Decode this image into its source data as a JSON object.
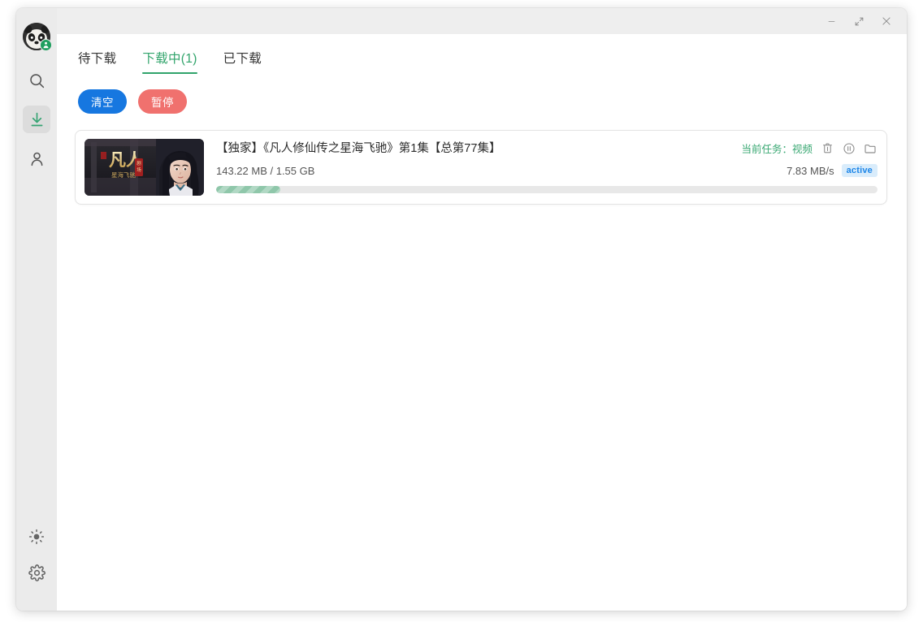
{
  "window": {
    "controls": {
      "minimize_label": "—",
      "minimize_icon": "minimize-icon",
      "maximize_icon": "maximize-icon",
      "close_label": "✕",
      "close_icon": "close-icon"
    }
  },
  "sidebar": {
    "avatar": {
      "name": "panda-avatar",
      "badge_icon": "user-verified-badge-icon"
    },
    "items": [
      {
        "icon": "search-icon",
        "name": "sidebar-item-search",
        "active": false
      },
      {
        "icon": "download-icon",
        "name": "sidebar-item-downloads",
        "active": true
      },
      {
        "icon": "person-icon",
        "name": "sidebar-item-account",
        "active": false
      }
    ],
    "bottom_items": [
      {
        "icon": "brightness-icon",
        "name": "sidebar-item-theme"
      },
      {
        "icon": "gear-icon",
        "name": "sidebar-item-settings"
      }
    ]
  },
  "tabs": [
    {
      "label": "待下载",
      "active": false
    },
    {
      "label": "下载中(1)",
      "active": true
    },
    {
      "label": "已下载",
      "active": false
    }
  ],
  "actions": {
    "clear_label": "清空",
    "pause_label": "暂停",
    "clear_color": "#1677e0",
    "pause_color": "#f0716e"
  },
  "downloads": [
    {
      "title": "【独家】《凡人修仙传之星海飞驰》第1集【总第77集】",
      "size_text": "143.22 MB / 1.55 GB",
      "downloaded": "143.22 MB",
      "total": "1.55 GB",
      "speed": "7.83 MB/s",
      "status_badge": "active",
      "current_task_label": "当前任务：视频",
      "progress_percent": 9.7,
      "thumbnail": {
        "name": "video-thumbnail",
        "title_cn": "凡人",
        "subtitle_cn": "星海飞驰"
      },
      "row_icons": [
        {
          "icon": "trash-icon",
          "name": "delete-task-button"
        },
        {
          "icon": "pause-circle-icon",
          "name": "pause-task-button"
        },
        {
          "icon": "folder-icon",
          "name": "open-folder-button"
        }
      ]
    }
  ],
  "colors": {
    "accent_green": "#31a46b",
    "badge_blue": "#1d86e8",
    "badge_bg": "#d9ecfb",
    "progress_fill": "#8fc7aa",
    "progress_track": "#e8e8e8"
  }
}
